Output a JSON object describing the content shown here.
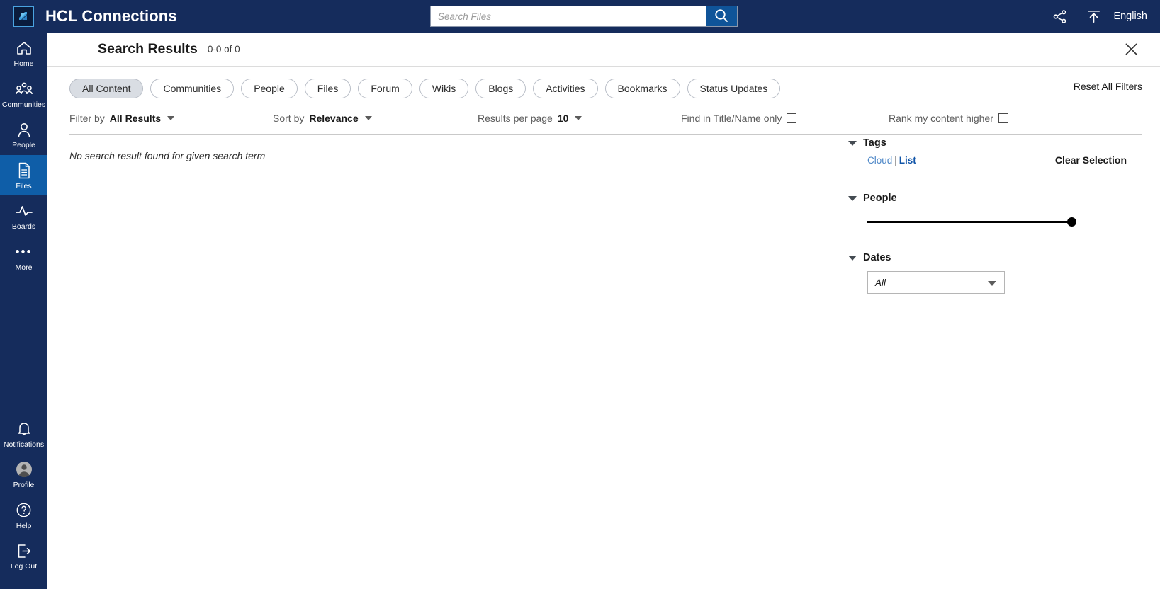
{
  "header": {
    "brand": "HCL Connections",
    "logo_icon": "hcl-logo-icon",
    "search": {
      "placeholder": "Search Files",
      "value": "",
      "button_icon": "search-icon"
    },
    "share_icon": "share-icon",
    "upload_icon": "upload-icon",
    "language": "English",
    "bg_color": "#152c5c"
  },
  "sidebar": {
    "items": [
      {
        "label": "Home",
        "icon": "home-icon",
        "active": false
      },
      {
        "label": "Communities",
        "icon": "communities-icon",
        "active": false
      },
      {
        "label": "People",
        "icon": "person-icon",
        "active": false
      },
      {
        "label": "Files",
        "icon": "file-icon",
        "active": true
      },
      {
        "label": "Boards",
        "icon": "boards-icon",
        "active": false
      },
      {
        "label": "More",
        "icon": "ellipsis-icon",
        "active": false
      }
    ],
    "bottom_items": [
      {
        "label": "Notifications",
        "icon": "bell-icon"
      },
      {
        "label": "Profile",
        "icon": "avatar-icon"
      },
      {
        "label": "Help",
        "icon": "question-circle-icon"
      },
      {
        "label": "Log Out",
        "icon": "logout-icon"
      }
    ],
    "active_color": "#0f5ea8"
  },
  "page": {
    "title": "Search Results",
    "count": "0-0 of 0",
    "close_icon": "close-icon"
  },
  "chips": {
    "items": [
      {
        "label": "All Content",
        "selected": true
      },
      {
        "label": "Communities",
        "selected": false
      },
      {
        "label": "People",
        "selected": false
      },
      {
        "label": "Files",
        "selected": false
      },
      {
        "label": "Forum",
        "selected": false
      },
      {
        "label": "Wikis",
        "selected": false
      },
      {
        "label": "Blogs",
        "selected": false
      },
      {
        "label": "Activities",
        "selected": false
      },
      {
        "label": "Bookmarks",
        "selected": false
      },
      {
        "label": "Status Updates",
        "selected": false
      }
    ],
    "reset_label": "Reset All Filters"
  },
  "toolbar": {
    "filter_by_label": "Filter by",
    "filter_by_value": "All Results",
    "sort_by_label": "Sort by",
    "sort_by_value": "Relevance",
    "results_per_page_label": "Results per page",
    "results_per_page_value": "10",
    "title_only_label": "Find in Title/Name only",
    "title_only_checked": false,
    "rank_higher_label": "Rank my content higher",
    "rank_higher_checked": false
  },
  "results": {
    "empty_message": "No search result found for given search term"
  },
  "filters": {
    "tags": {
      "title": "Tags",
      "cloud_label": "Cloud",
      "separator": "|",
      "list_label": "List",
      "clear_label": "Clear Selection"
    },
    "people": {
      "title": "People",
      "slider_position": "100"
    },
    "dates": {
      "title": "Dates",
      "selected": "All"
    }
  }
}
